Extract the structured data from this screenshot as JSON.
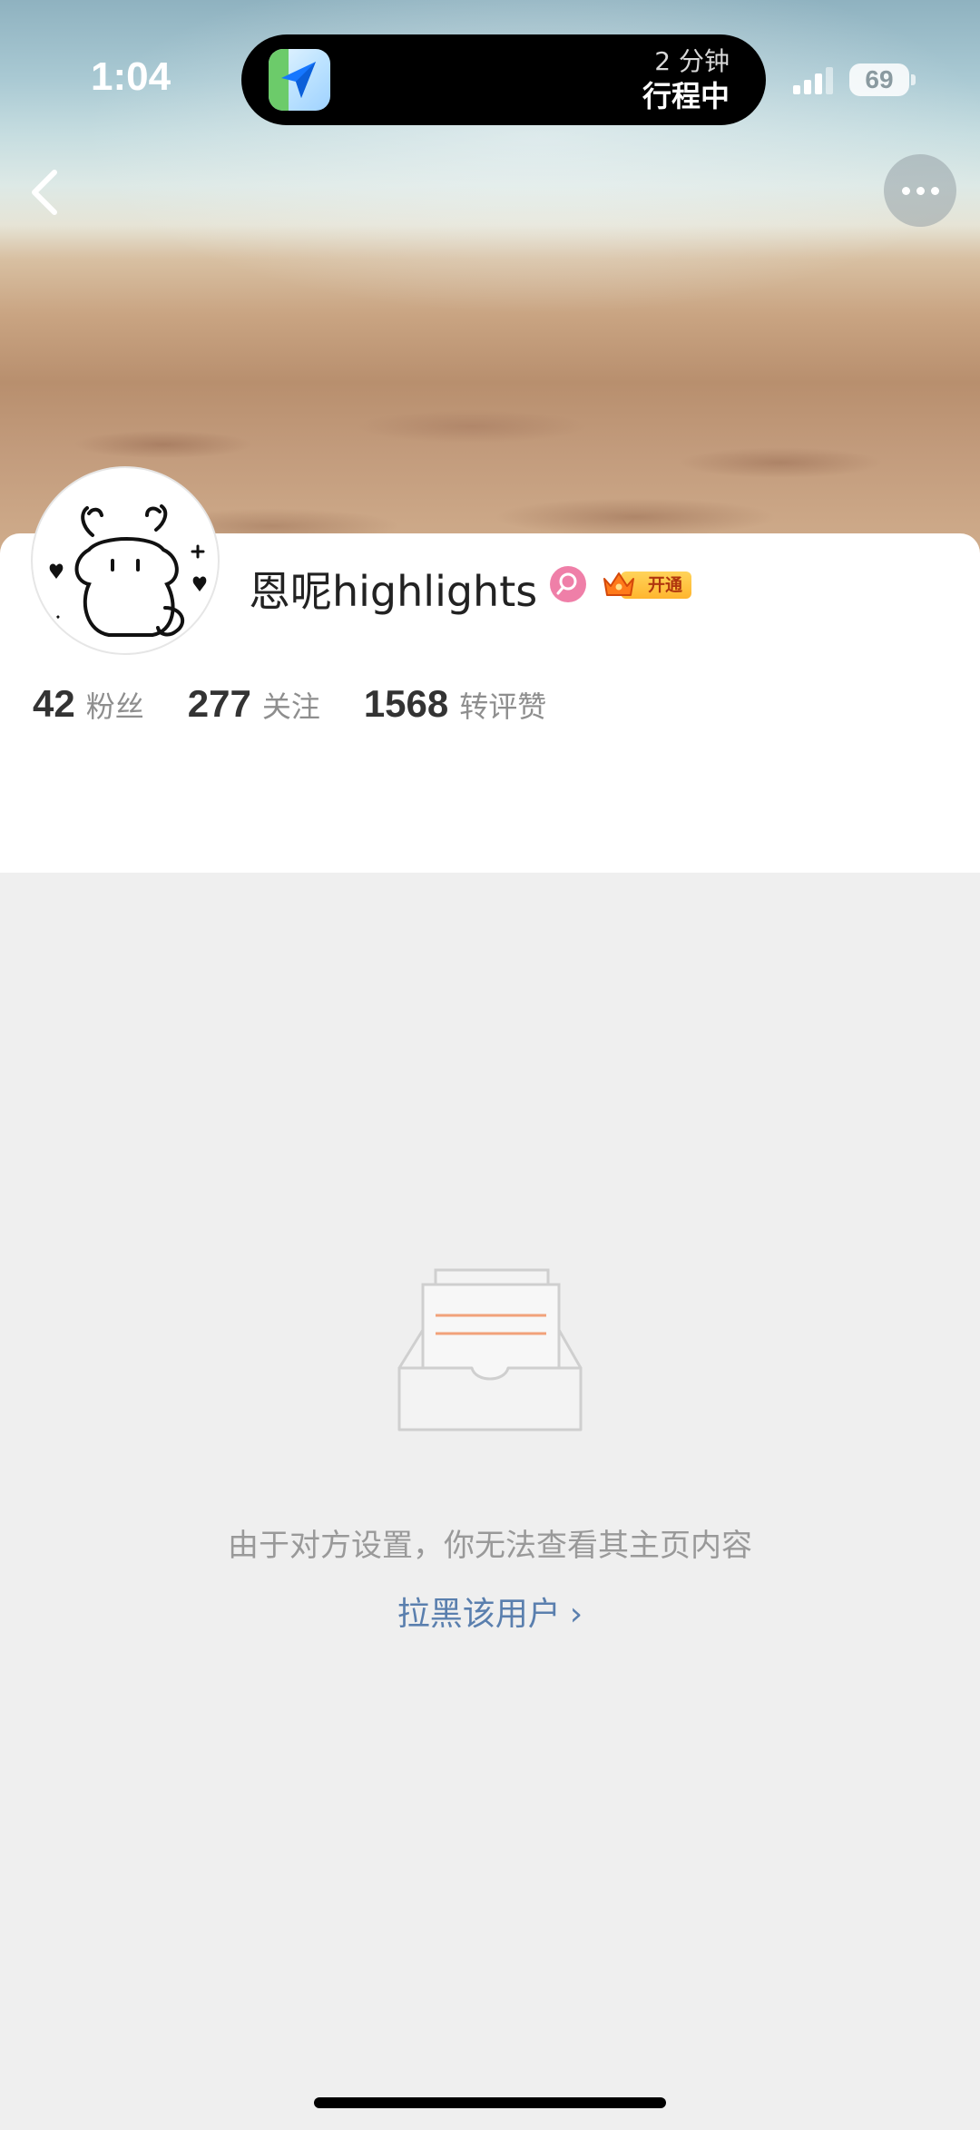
{
  "status_bar": {
    "time": "1:04",
    "battery": "69",
    "live_activity": {
      "eta_top": "2 分钟",
      "eta_bottom": "行程中"
    }
  },
  "nav": {
    "back_icon": "chevron-left-icon",
    "more_icon": "more-dots-icon"
  },
  "profile": {
    "username": "恩呢highlights",
    "verified_icon": "verified-search-icon",
    "vip_badge_label": "开通",
    "stats": [
      {
        "value": "42",
        "label": "粉丝"
      },
      {
        "value": "277",
        "label": "关注"
      },
      {
        "value": "1568",
        "label": "转评赞"
      }
    ]
  },
  "empty_state": {
    "icon": "empty-inbox-icon",
    "message": "由于对方设置，你无法查看其主页内容",
    "link_label": "拉黑该用户",
    "link_chevron": "›"
  },
  "colors": {
    "link": "#5a7fae",
    "verified_badge": "#ef7fa8",
    "vip_badge": "#ffb52e",
    "page_background": "#efefef"
  }
}
